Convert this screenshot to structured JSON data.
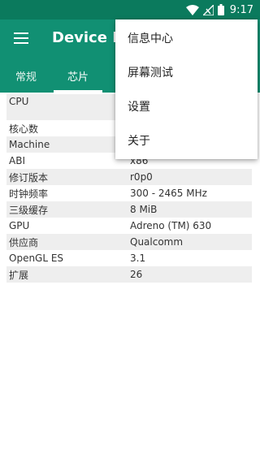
{
  "status_bar": {
    "time": "9:17"
  },
  "app_bar": {
    "title": "Device Info"
  },
  "tabs": [
    {
      "label": "常规"
    },
    {
      "label": "芯片"
    }
  ],
  "table": {
    "rows": [
      {
        "key": "CPU",
        "value": ""
      },
      {
        "key": "核心数",
        "value": ""
      },
      {
        "key": "Machine",
        "value": ""
      },
      {
        "key": "ABI",
        "value": "x86"
      },
      {
        "key": "修订版本",
        "value": "r0p0"
      },
      {
        "key": "时钟频率",
        "value": "300 - 2465 MHz"
      },
      {
        "key": "三级缓存",
        "value": "8 MiB"
      },
      {
        "key": "GPU",
        "value": "Adreno (TM) 630"
      },
      {
        "key": "供应商",
        "value": "Qualcomm"
      },
      {
        "key": "OpenGL ES",
        "value": "3.1"
      },
      {
        "key": "扩展",
        "value": "26"
      }
    ]
  },
  "overflow_menu": {
    "items": [
      {
        "label": "信息中心"
      },
      {
        "label": "屏幕测试"
      },
      {
        "label": "设置"
      },
      {
        "label": "关于"
      }
    ]
  },
  "colors": {
    "status_bar": "#0b7a5d",
    "app_bar": "#119073",
    "row_alt": "#eeeeee"
  },
  "icons": [
    "wifi-icon",
    "signal-icon",
    "battery-icon",
    "menu-icon"
  ]
}
